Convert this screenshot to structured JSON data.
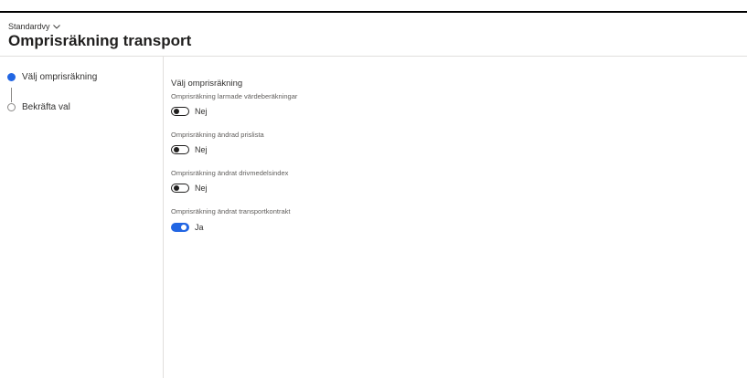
{
  "header": {
    "view_selector": "Standardvy",
    "title": "Omprisräkning transport"
  },
  "steps": [
    {
      "label": "Välj omprisräkning",
      "active": true
    },
    {
      "label": "Bekräfta val",
      "active": false
    }
  ],
  "main": {
    "section_title": "Välj omprisräkning",
    "fields": [
      {
        "label": "Omprisräkning larmade värdeberäkningar",
        "value": "Nej",
        "on": false
      },
      {
        "label": "Omprisräkning ändrad prislista",
        "value": "Nej",
        "on": false
      },
      {
        "label": "Omprisräkning ändrat drivmedelsindex",
        "value": "Nej",
        "on": false
      },
      {
        "label": "Omprisräkning ändrat transportkontrakt",
        "value": "Ja",
        "on": true
      }
    ]
  },
  "colors": {
    "accent": "#2266e3",
    "border": "#e1dfdd"
  }
}
